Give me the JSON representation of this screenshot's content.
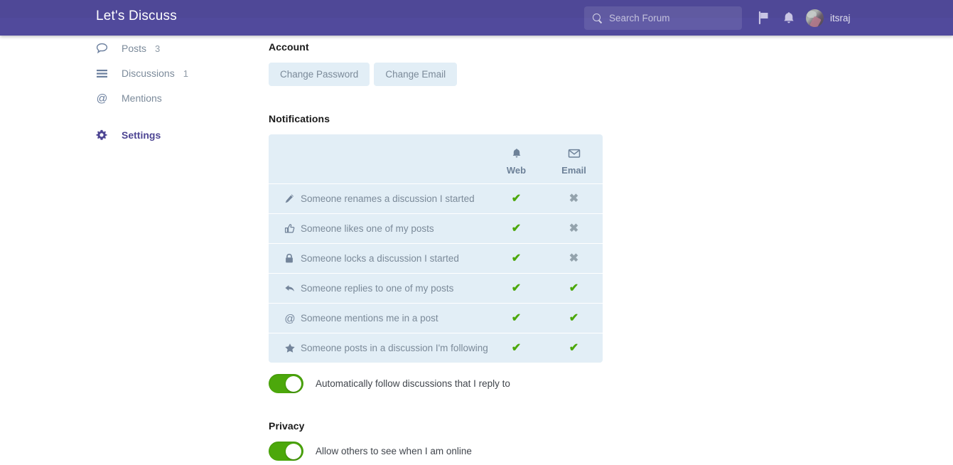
{
  "header": {
    "title": "Let's Discuss",
    "search": {
      "placeholder": "Search Forum",
      "icon": "search-icon"
    },
    "flag_icon": "flag-icon",
    "bell_icon": "bell-icon",
    "user": {
      "name": "itsraj",
      "avatar_icon": "avatar"
    },
    "accent_color": "#4D4593"
  },
  "sidebar": {
    "items": [
      {
        "label": "Posts",
        "count": "3",
        "icon": "comment-icon",
        "active": false
      },
      {
        "label": "Discussions",
        "count": "1",
        "icon": "list-icon",
        "active": false
      },
      {
        "label": "Mentions",
        "count": "",
        "icon": "at-icon",
        "active": false
      },
      {
        "label": "Settings",
        "count": "",
        "icon": "gear-icon",
        "active": true
      }
    ]
  },
  "main": {
    "account": {
      "title": "Account",
      "change_password_label": "Change Password",
      "change_email_label": "Change Email"
    },
    "notifications": {
      "title": "Notifications",
      "columns": [
        {
          "label": "Web",
          "icon": "bell-icon"
        },
        {
          "label": "Email",
          "icon": "envelope-icon"
        }
      ],
      "rows": [
        {
          "icon": "pencil-icon",
          "label": "Someone renames a discussion I started",
          "web": "on",
          "email": "off"
        },
        {
          "icon": "thumbsup-icon",
          "label": "Someone likes one of my posts",
          "web": "on",
          "email": "off"
        },
        {
          "icon": "lock-icon",
          "label": "Someone locks a discussion I started",
          "web": "on",
          "email": "off"
        },
        {
          "icon": "reply-icon",
          "label": "Someone replies to one of my posts",
          "web": "on",
          "email": "on"
        },
        {
          "icon": "at-icon",
          "label": "Someone mentions me in a post",
          "web": "on",
          "email": "on"
        },
        {
          "icon": "star-icon",
          "label": "Someone posts in a discussion I'm following",
          "web": "on",
          "email": "on"
        }
      ],
      "check_glyph": "✔",
      "cross_glyph": "✖",
      "on_color": "#4CA80B",
      "off_color": "#94a3ad",
      "follow_toggle": {
        "label": "Automatically follow discussions that I reply to",
        "state": "on"
      }
    },
    "privacy": {
      "title": "Privacy",
      "online_toggle": {
        "label": "Allow others to see when I am online",
        "state": "on"
      }
    }
  }
}
